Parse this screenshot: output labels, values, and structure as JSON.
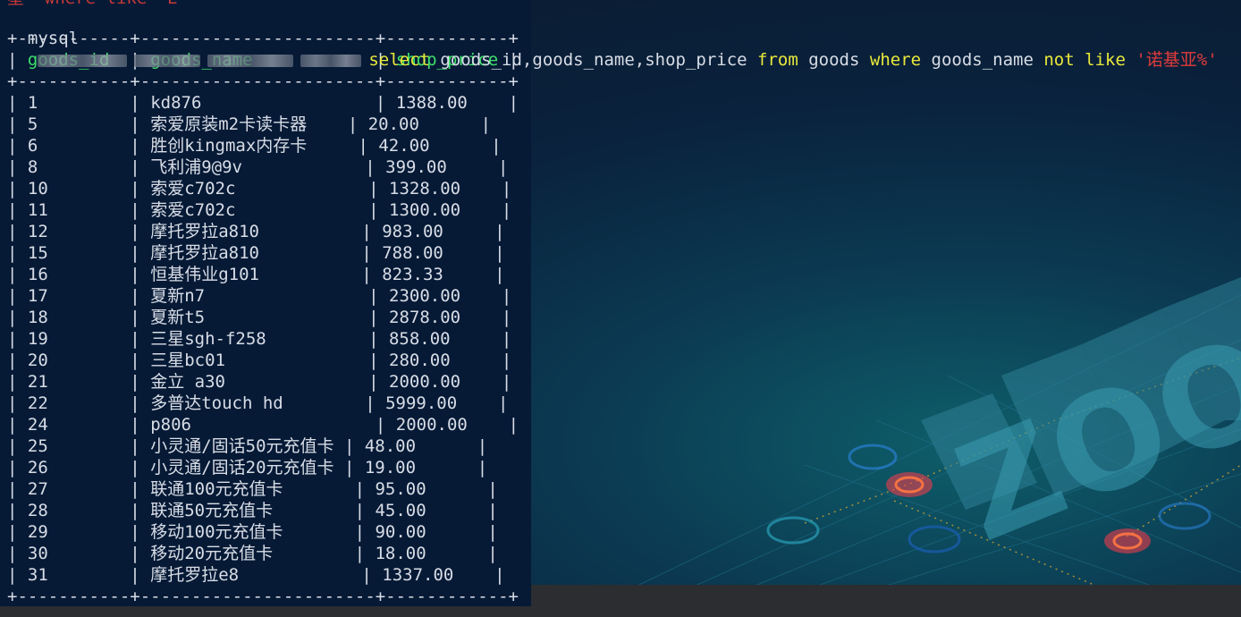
{
  "terminal": {
    "top_fragment": "星  where like 'E'",
    "prompt": "mysql",
    "command_parts": [
      {
        "text": "select",
        "type": "kw"
      },
      {
        "text": " goods_id,goods_name,shop_price ",
        "type": "plain"
      },
      {
        "text": "from",
        "type": "kw"
      },
      {
        "text": " goods ",
        "type": "plain"
      },
      {
        "text": "where",
        "type": "kw"
      },
      {
        "text": " goods_name ",
        "type": "plain"
      },
      {
        "text": "not",
        "type": "kw"
      },
      {
        "text": " ",
        "type": "plain"
      },
      {
        "text": "like",
        "type": "kw"
      },
      {
        "text": " ",
        "type": "plain"
      },
      {
        "text": "'诺基亚%'",
        "type": "str"
      }
    ],
    "border": "+-----------+-----------------------+------------+",
    "columns": [
      "goods_id",
      "goods_name",
      "shop_price"
    ],
    "rows": [
      [
        "1",
        "kd876",
        "1388.00"
      ],
      [
        "5",
        "索爱原装m2卡读卡器",
        "20.00"
      ],
      [
        "6",
        "胜创kingmax内存卡",
        "42.00"
      ],
      [
        "8",
        "飞利浦9@9v",
        "399.00"
      ],
      [
        "10",
        "索爱c702c",
        "1328.00"
      ],
      [
        "11",
        "索爱c702c",
        "1300.00"
      ],
      [
        "12",
        "摩托罗拉a810",
        "983.00"
      ],
      [
        "15",
        "摩托罗拉a810",
        "788.00"
      ],
      [
        "16",
        "恒基伟业g101",
        "823.33"
      ],
      [
        "17",
        "夏新n7",
        "2300.00"
      ],
      [
        "18",
        "夏新t5",
        "2878.00"
      ],
      [
        "19",
        "三星sgh-f258",
        "858.00"
      ],
      [
        "20",
        "三星bc01",
        "280.00"
      ],
      [
        "21",
        "金立 a30",
        "2000.00"
      ],
      [
        "22",
        "多普达touch hd",
        "5999.00"
      ],
      [
        "24",
        "p806",
        "2000.00"
      ],
      [
        "25",
        "小灵通/固话50元充值卡",
        "48.00"
      ],
      [
        "26",
        "小灵通/固话20元充值卡",
        "19.00"
      ],
      [
        "27",
        "联通100元充值卡",
        "95.00"
      ],
      [
        "28",
        "联通50元充值卡",
        "45.00"
      ],
      [
        "29",
        "移动100元充值卡",
        "90.00"
      ],
      [
        "30",
        "移动20元充值卡",
        "18.00"
      ],
      [
        "31",
        "摩托罗拉e8",
        "1337.00"
      ]
    ]
  },
  "wallpaper": {
    "text": "ZOOM",
    "colors": {
      "terminal_bg": "#061a36",
      "header": "#3fe06a",
      "keyword": "#e8e83a",
      "string": "#e03b3b"
    }
  }
}
